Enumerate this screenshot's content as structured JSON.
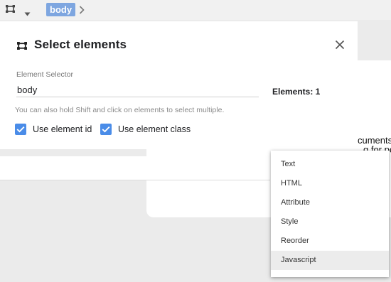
{
  "toolbar": {
    "select_icon": "select-element-icon",
    "caret_icon": "caret-down-icon",
    "breadcrumb": "body",
    "chevron_icon": "chevron-right-icon"
  },
  "background": {
    "text_line1": "cuments",
    "text_line2": "g for pe"
  },
  "dialog": {
    "title": "Select elements",
    "title_icon": "select-element-icon",
    "close_icon": "close-icon",
    "selector_label": "Element Selector",
    "selector_value": "body",
    "elements_count": "Elements: 1",
    "hint": "You can also hold Shift and click on elements to select multiple.",
    "use_id_label": "Use element id",
    "use_id_checked": true,
    "use_class_label": "Use element class",
    "use_class_checked": true,
    "accent_color": "#4a8ce8"
  },
  "menu": {
    "items": [
      {
        "label": "Text"
      },
      {
        "label": "HTML"
      },
      {
        "label": "Attribute"
      },
      {
        "label": "Style"
      },
      {
        "label": "Reorder"
      },
      {
        "label": "Javascript"
      }
    ],
    "highlighted": "Javascript"
  }
}
